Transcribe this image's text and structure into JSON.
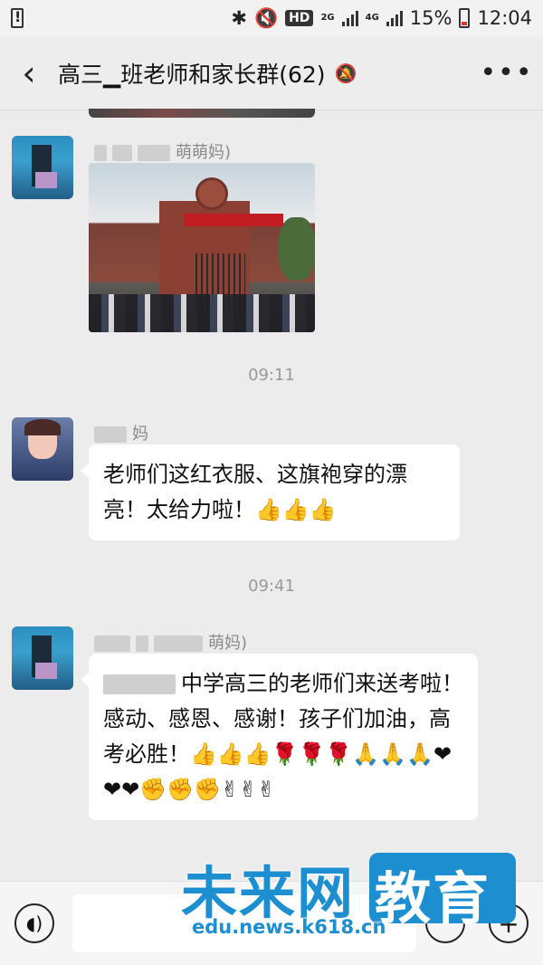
{
  "status_bar": {
    "network_badge": "HD",
    "net_2g": "2G",
    "net_4g": "4G",
    "battery": "15%",
    "time": "12:04"
  },
  "header": {
    "back_icon": "chevron-left-icon",
    "title": "高三▁班老师和家长群(62)",
    "mute_icon": "bell-off-icon",
    "more_icon": "more-dots-icon"
  },
  "messages": [
    {
      "sender_suffix": "萌萌妈)",
      "type": "image"
    },
    {
      "time": "09:11"
    },
    {
      "sender_suffix": "妈",
      "text": "老师们这红衣服、这旗袍穿的漂亮！太给力啦！👍👍👍"
    },
    {
      "time": "09:41"
    },
    {
      "sender_suffix": "萌妈)",
      "text": "中学高三的老师们来送考啦！感动、感恩、感谢！孩子们加油，高考必胜！👍👍👍🌹🌹🌹🙏🙏🙏❤❤❤✊✊✊✌✌✌"
    }
  ],
  "input_bar": {
    "voice_icon": "voice-icon",
    "emoji_icon": "emoji-icon",
    "plus_icon": "plus-icon"
  },
  "watermark": {
    "title": "未来网",
    "box_text": "教育",
    "url": "edu.news.k618.cn"
  }
}
